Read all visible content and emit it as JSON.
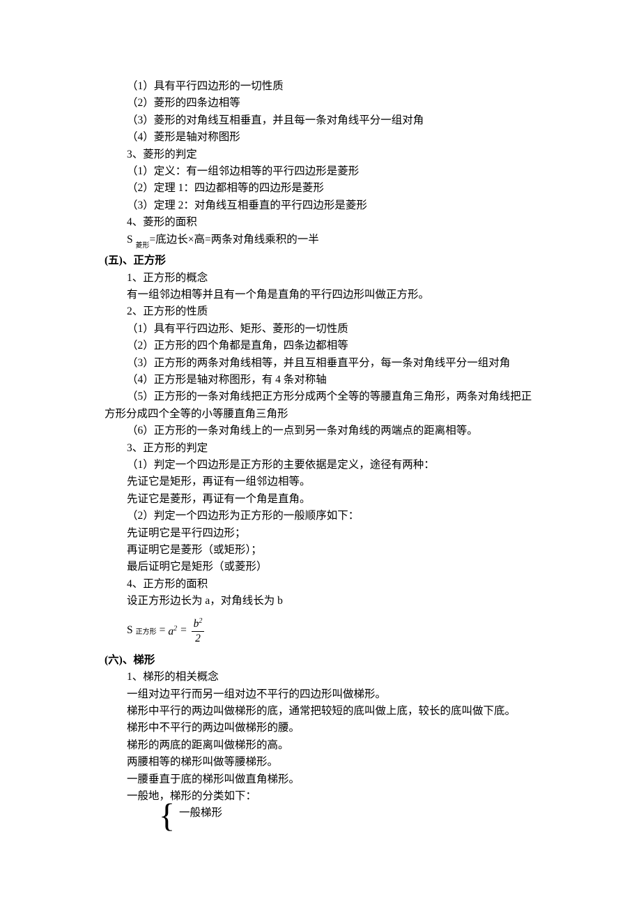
{
  "lines": {
    "l1": "（1）具有平行四边形的一切性质",
    "l2": "（2）菱形的四条边相等",
    "l3": "（3）菱形的对角线互相垂直，并且每一条对角线平分一组对角",
    "l4": "（4）菱形是轴对称图形",
    "l5": "3、菱形的判定",
    "l6": "（1）定义：有一组邻边相等的平行四边形是菱形",
    "l7": "（2）定理 1：四边都相等的四边形是菱形",
    "l8": "（3）定理 2：对角线互相垂直的平行四边形是菱形",
    "l9": "4、菱形的面积",
    "l10_pre": "S ",
    "l10_sub": "菱形",
    "l10_post": "=底边长×高=两条对角线乘积的一半",
    "h5": "(五)、正方形",
    "l11": "1、正方形的概念",
    "l12": "有一组邻边相等并且有一个角是直角的平行四边形叫做正方形。",
    "l13": "2、正方形的性质",
    "l14": "（1）具有平行四边形、矩形、菱形的一切性质",
    "l15": "（2）正方形的四个角都是直角，四条边都相等",
    "l16": "（3）正方形的两条对角线相等，并且互相垂直平分，每一条对角线平分一组对角",
    "l17": "（4）正方形是轴对称图形，有 4 条对称轴",
    "l18": "（5）正方形的一条对角线把正方形分成两个全等的等腰直角三角形，两条对角线把正",
    "l18b": "方形分成四个全等的小等腰直角三角形",
    "l19": "（6）正方形的一条对角线上的一点到另一条对角线的两端点的距离相等。",
    "l20": "3、正方形的判定",
    "l21": "（1）判定一个四边形是正方形的主要依据是定义，途径有两种：",
    "l22": "先证它是矩形，再证有一组邻边相等。",
    "l23": "先证它是菱形，再证有一个角是直角。",
    "l24": "（2）判定一个四边形为正方形的一般顺序如下：",
    "l25": "先证明它是平行四边形；",
    "l26": "再证明它是菱形（或矩形）；",
    "l27": "最后证明它是矩形（或菱形）",
    "l28": "4、正方形的面积",
    "l29": "设正方形边长为 a，对角线长为 b",
    "fml_pre": "S ",
    "fml_sub": "正方形",
    "fml_eq": "=",
    "fml_a": "a",
    "fml_a_exp": "2",
    "fml_eq2": " = ",
    "fml_num_b": "b",
    "fml_num_exp": "2",
    "fml_den": "2",
    "h6": "(六)、梯形",
    "l30": "1、梯形的相关概念",
    "l31": "一组对边平行而另一组对边不平行的四边形叫做梯形。",
    "l32": "梯形中平行的两边叫做梯形的底，通常把较短的底叫做上底，较长的底叫做下底。",
    "l33": "梯形中不平行的两边叫做梯形的腰。",
    "l34": "梯形的两底的距离叫做梯形的高。",
    "l35": "两腰相等的梯形叫做等腰梯形。",
    "l36": "一腰垂直于底的梯形叫做直角梯形。",
    "l37": "一般地，梯形的分类如下：",
    "brace_item": "一般梯形"
  }
}
